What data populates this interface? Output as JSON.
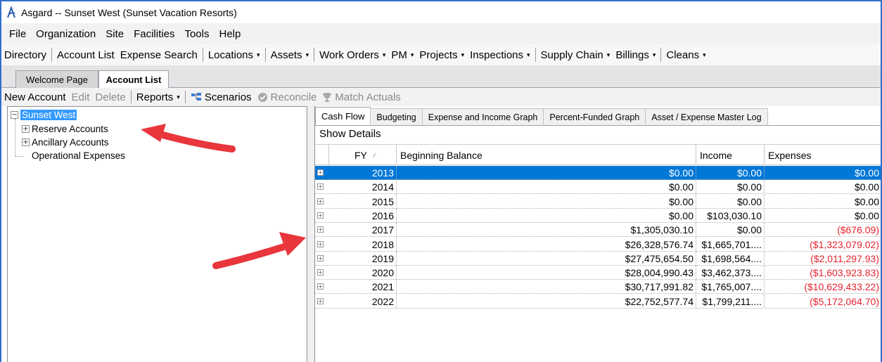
{
  "window": {
    "title": "Asgard -- Sunset West (Sunset Vacation Resorts)"
  },
  "menu": [
    "File",
    "Organization",
    "Site",
    "Facilities",
    "Tools",
    "Help"
  ],
  "navbar": [
    {
      "label": "Directory",
      "dropdown": false
    },
    {
      "label": "Account List",
      "dropdown": false
    },
    {
      "label": "Expense Search",
      "dropdown": false
    },
    {
      "label": "Locations",
      "dropdown": true
    },
    {
      "label": "Assets",
      "dropdown": true
    },
    {
      "label": "Work Orders",
      "dropdown": true
    },
    {
      "label": "PM",
      "dropdown": true
    },
    {
      "label": "Projects",
      "dropdown": true
    },
    {
      "label": "Inspections",
      "dropdown": true
    },
    {
      "label": "Supply Chain",
      "dropdown": true
    },
    {
      "label": "Billings",
      "dropdown": true
    },
    {
      "label": "Cleans",
      "dropdown": true
    }
  ],
  "doc_tabs": {
    "inactive": "Welcome Page",
    "active": "Account List"
  },
  "actions": {
    "new_account": "New Account",
    "edit": "Edit",
    "delete": "Delete",
    "reports": "Reports",
    "scenarios": "Scenarios",
    "reconcile": "Reconcile",
    "match_actuals": "Match Actuals"
  },
  "tree": {
    "root": "Sunset West",
    "children": [
      "Reserve Accounts",
      "Ancillary Accounts",
      "Operational Expenses"
    ]
  },
  "subtabs": [
    "Cash Flow",
    "Budgeting",
    "Expense and Income Graph",
    "Percent-Funded Graph",
    "Asset / Expense Master Log"
  ],
  "show_details": "Show Details",
  "grid": {
    "columns": [
      "FY",
      "Beginning Balance",
      "Income",
      "Expenses"
    ],
    "rows": [
      {
        "fy": "2013",
        "balance": "$0.00",
        "income": "$0.00",
        "expenses": "$0.00",
        "negative": false
      },
      {
        "fy": "2014",
        "balance": "$0.00",
        "income": "$0.00",
        "expenses": "$0.00",
        "negative": false
      },
      {
        "fy": "2015",
        "balance": "$0.00",
        "income": "$0.00",
        "expenses": "$0.00",
        "negative": false
      },
      {
        "fy": "2016",
        "balance": "$0.00",
        "income": "$103,030.10",
        "expenses": "$0.00",
        "negative": false
      },
      {
        "fy": "2017",
        "balance": "$1,305,030.10",
        "income": "$0.00",
        "expenses": "($676.09)",
        "negative": true
      },
      {
        "fy": "2018",
        "balance": "$26,328,576.74",
        "income": "$1,665,701....",
        "expenses": "($1,323,079.02)",
        "negative": true
      },
      {
        "fy": "2019",
        "balance": "$27,475,654.50",
        "income": "$1,698,564....",
        "expenses": "($2,011,297.93)",
        "negative": true
      },
      {
        "fy": "2020",
        "balance": "$28,004,990.43",
        "income": "$3,462,373....",
        "expenses": "($1,603,923.83)",
        "negative": true
      },
      {
        "fy": "2021",
        "balance": "$30,717,991.82",
        "income": "$1,765,007....",
        "expenses": "($10,629,433.22)",
        "negative": true
      },
      {
        "fy": "2022",
        "balance": "$22,752,577.74",
        "income": "$1,799,211....",
        "expenses": "($5,172,064.70)",
        "negative": true
      }
    ]
  },
  "colors": {
    "selection": "#0078d7",
    "negative": "#e8232e",
    "annotation_arrow": "#e8363c",
    "window_border": "#2f6fc9"
  }
}
